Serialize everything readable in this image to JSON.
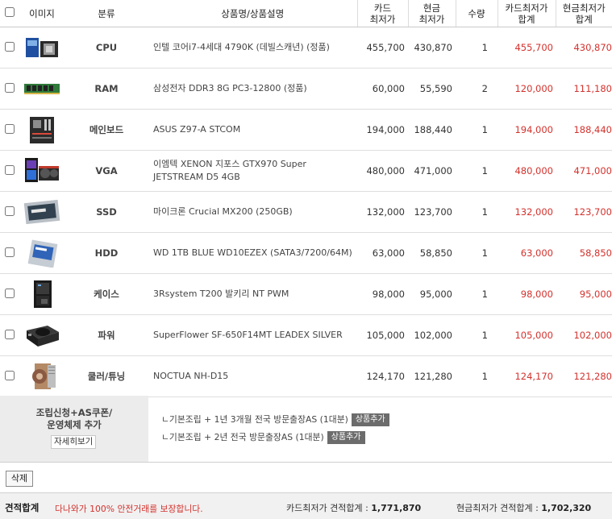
{
  "headers": {
    "image": "이미지",
    "category": "분류",
    "product": "상품명/상품설명",
    "card_min_1": "카드",
    "card_min_2": "최저가",
    "cash_min_1": "현금",
    "cash_min_2": "최저가",
    "qty": "수량",
    "card_total_1": "카드최저가",
    "card_total_2": "합계",
    "cash_total_1": "현금최저가",
    "cash_total_2": "합계"
  },
  "rows": [
    {
      "category": "CPU",
      "name_1": "인텔 코어i7-4세대 4790K (데빌스캐년) (정품)",
      "name_2": "",
      "card": "455,700",
      "cash": "430,870",
      "qty": "1",
      "card_sum": "455,700",
      "cash_sum": "430,870",
      "icon": "cpu-box-icon"
    },
    {
      "category": "RAM",
      "name_1": "삼성전자 DDR3 8G PC3-12800 (정품)",
      "name_2": "",
      "card": "60,000",
      "cash": "55,590",
      "qty": "2",
      "card_sum": "120,000",
      "cash_sum": "111,180",
      "icon": "ram-stick-icon"
    },
    {
      "category": "메인보드",
      "name_1": "ASUS Z97-A STCOM",
      "name_2": "",
      "card": "194,000",
      "cash": "188,440",
      "qty": "1",
      "card_sum": "194,000",
      "cash_sum": "188,440",
      "icon": "motherboard-icon"
    },
    {
      "category": "VGA",
      "name_1": "이엠텍 XENON 지포스 GTX970 Super",
      "name_2": "JETSTREAM D5 4GB",
      "card": "480,000",
      "cash": "471,000",
      "qty": "1",
      "card_sum": "480,000",
      "cash_sum": "471,000",
      "icon": "graphics-card-icon"
    },
    {
      "category": "SSD",
      "name_1": "마이크론 Crucial MX200 (250GB)",
      "name_2": "",
      "card": "132,000",
      "cash": "123,700",
      "qty": "1",
      "card_sum": "132,000",
      "cash_sum": "123,700",
      "icon": "ssd-icon"
    },
    {
      "category": "HDD",
      "name_1": "WD 1TB BLUE WD10EZEX (SATA3/7200/64M)",
      "name_2": "",
      "card": "63,000",
      "cash": "58,850",
      "qty": "1",
      "card_sum": "63,000",
      "cash_sum": "58,850",
      "icon": "hdd-icon"
    },
    {
      "category": "케이스",
      "name_1": "3Rsystem T200 발키리 NT PWM",
      "name_2": "",
      "card": "98,000",
      "cash": "95,000",
      "qty": "1",
      "card_sum": "98,000",
      "cash_sum": "95,000",
      "icon": "pc-case-icon"
    },
    {
      "category": "파워",
      "name_1": "SuperFlower SF-650F14MT LEADEX SILVER",
      "name_2": "",
      "card": "105,000",
      "cash": "102,000",
      "qty": "1",
      "card_sum": "105,000",
      "cash_sum": "102,000",
      "icon": "power-supply-icon"
    },
    {
      "category": "쿨러/튜닝",
      "name_1": "NOCTUA NH-D15",
      "name_2": "",
      "card": "124,170",
      "cash": "121,280",
      "qty": "1",
      "card_sum": "124,170",
      "cash_sum": "121,280",
      "icon": "cpu-cooler-icon"
    }
  ],
  "extra": {
    "title_1": "조립신청+AS쿠폰/",
    "title_2": "운영체제 추가",
    "detail_button": "자세히보기",
    "options": [
      {
        "label": "ㄴ기본조립 + 1년 3개월 전국 방문출장AS (1대분)",
        "button": "상품추가"
      },
      {
        "label": "ㄴ기본조립 + 2년 전국 방문출장AS (1대분)",
        "button": "상품추가"
      }
    ]
  },
  "delete_button": "삭제",
  "footer": {
    "label": "견적합계",
    "note": "다나와가 100% 안전거래를 보장합니다.",
    "card_label": "카드최저가 견적합계 : ",
    "card_total": "1,771,870",
    "cash_label": "현금최저가 견적합계 : ",
    "cash_total": "1,702,320"
  }
}
